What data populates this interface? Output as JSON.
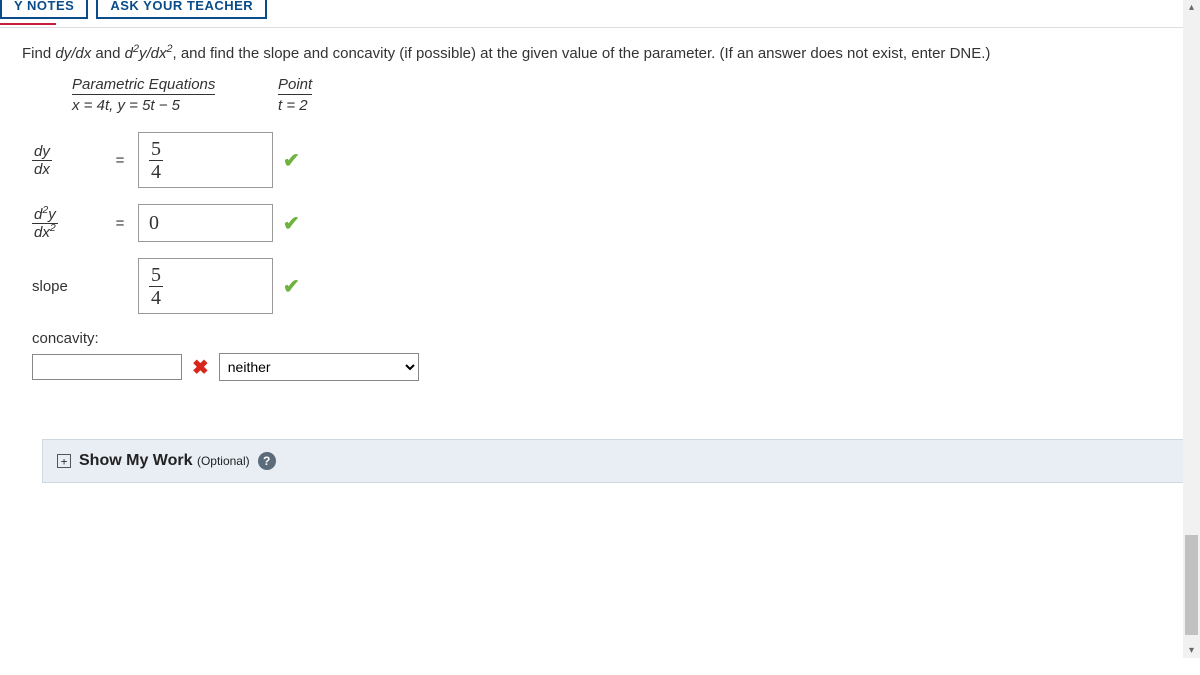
{
  "top_buttons": {
    "notes": "Y NOTES",
    "ask": "ASK YOUR TEACHER"
  },
  "prompt": {
    "prefix": "Find ",
    "dydx": "dy/dx",
    "and": " and ",
    "d2ydx2_a": "d",
    "d2ydx2_b": "y/dx",
    "suffix": ", and find the slope and concavity (if possible) at the given value of the parameter. (If an answer does not exist, enter DNE.)"
  },
  "table": {
    "hdr1": "Parametric Equations",
    "hdr2": "Point",
    "eq_x_lhs": "x",
    "eq_x_rhs": "4t",
    "eq_y_lhs": "y",
    "eq_y_rhs": "5t − 5",
    "sep": ",  ",
    "point_lhs": "t",
    "point_rhs": "2",
    "eqsign": " = "
  },
  "labels": {
    "dy": "dy",
    "dx": "dx",
    "d2y_num_a": "d",
    "d2y_num_b": "y",
    "d2y_den_a": "dx",
    "slope": "slope",
    "eq": "=",
    "concavity": "concavity:"
  },
  "answers": {
    "dydx_num": "5",
    "dydx_den": "4",
    "d2ydx2": "0",
    "slope_num": "5",
    "slope_den": "4",
    "concavity_input": "",
    "concavity_select": "neither"
  },
  "show_work": {
    "title": "Show My Work",
    "optional": "(Optional)"
  },
  "sup2": "2"
}
